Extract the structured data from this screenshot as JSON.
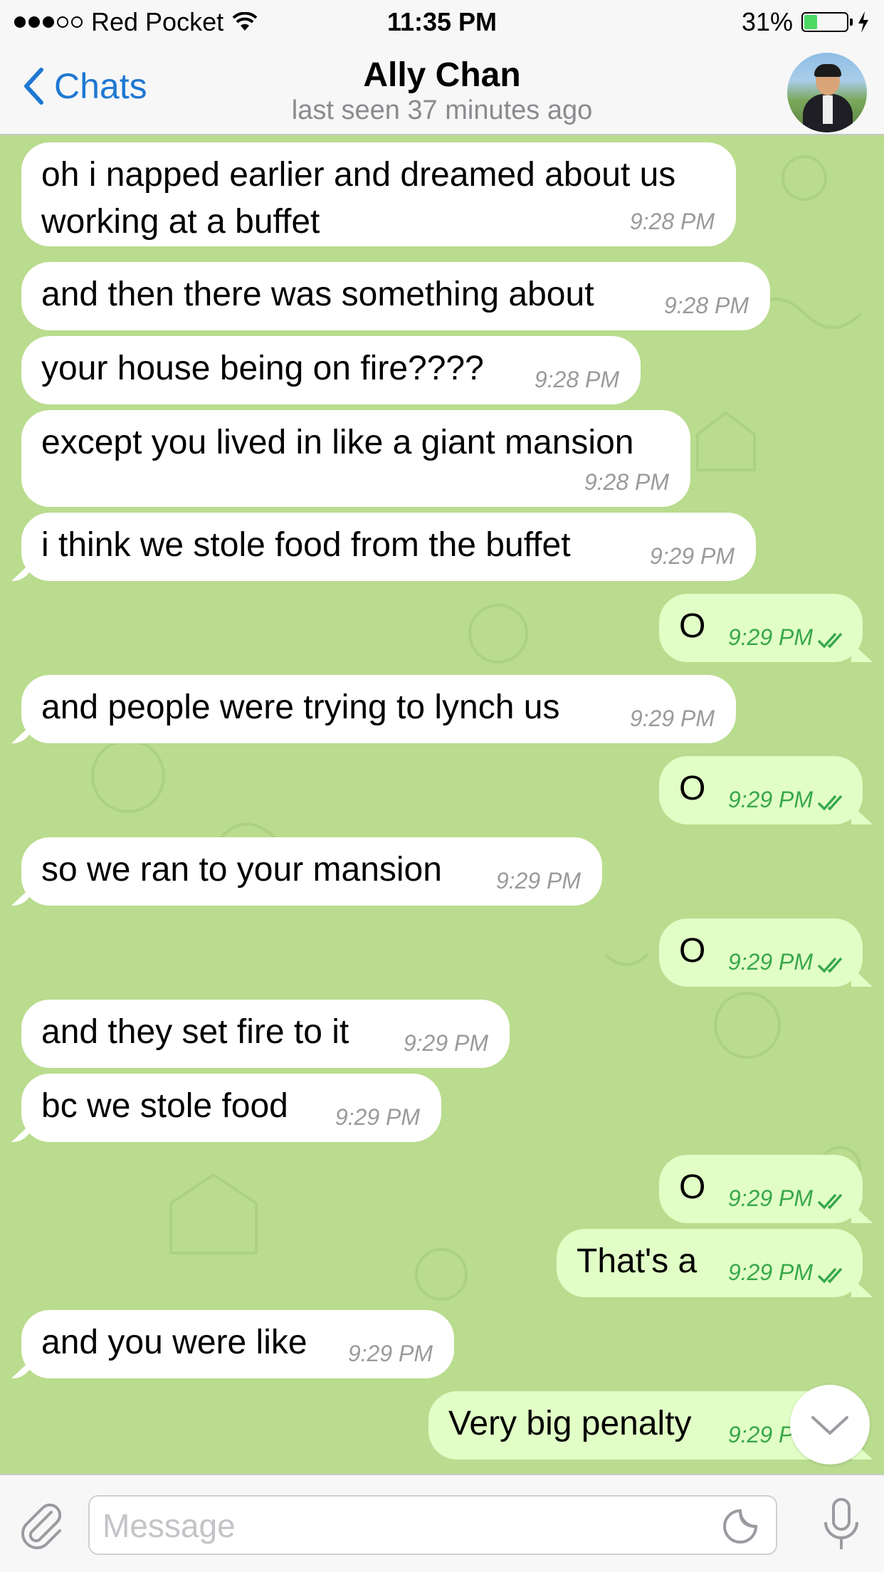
{
  "status_bar": {
    "carrier": "Red Pocket",
    "time": "11:35 PM",
    "battery_percent": "31%",
    "battery_level": 0.31,
    "signal_bars_filled": 3,
    "signal_bars_total": 5,
    "icons": [
      "wifi-icon",
      "battery-icon",
      "charging-bolt-icon"
    ]
  },
  "nav": {
    "back_label": "Chats",
    "title": "Ally Chan",
    "subtitle": "last seen 37 minutes ago"
  },
  "messages": [
    {
      "dir": "in",
      "text": "oh i napped earlier and dreamed about us\nworking at a buffet",
      "time": "9:28 PM"
    },
    {
      "dir": "in",
      "text": "and then there was something about",
      "time": "9:28 PM"
    },
    {
      "dir": "in",
      "text": "your house being on fire????",
      "time": "9:28 PM"
    },
    {
      "dir": "in",
      "text": "except you lived in like a giant mansion",
      "time": "9:28 PM"
    },
    {
      "dir": "in",
      "text": "i think we stole food from the buffet",
      "time": "9:29 PM"
    },
    {
      "dir": "out",
      "text": "O",
      "time": "9:29 PM",
      "read": true
    },
    {
      "dir": "in",
      "text": "and people were trying to lynch us",
      "time": "9:29 PM"
    },
    {
      "dir": "out",
      "text": "O",
      "time": "9:29 PM",
      "read": true
    },
    {
      "dir": "in",
      "text": "so we ran to your mansion",
      "time": "9:29 PM"
    },
    {
      "dir": "out",
      "text": "O",
      "time": "9:29 PM",
      "read": true
    },
    {
      "dir": "in",
      "text": "and they set fire to it",
      "time": "9:29 PM"
    },
    {
      "dir": "in",
      "text": "bc we stole food",
      "time": "9:29 PM"
    },
    {
      "dir": "out",
      "text": "O",
      "time": "9:29 PM",
      "read": true
    },
    {
      "dir": "out",
      "text": "That's a",
      "time": "9:29 PM",
      "read": true
    },
    {
      "dir": "in",
      "text": "and you were like",
      "time": "9:29 PM"
    },
    {
      "dir": "out",
      "text": "Very big penalty",
      "time": "9:29 PM",
      "read": true
    }
  ],
  "input": {
    "placeholder": "Message",
    "value": ""
  },
  "colors": {
    "background": "#b9dc8e",
    "incoming_bubble": "#ffffff",
    "outgoing_bubble": "#e1fec6",
    "outgoing_time": "#37a84a",
    "link_blue": "#1e78d2"
  }
}
